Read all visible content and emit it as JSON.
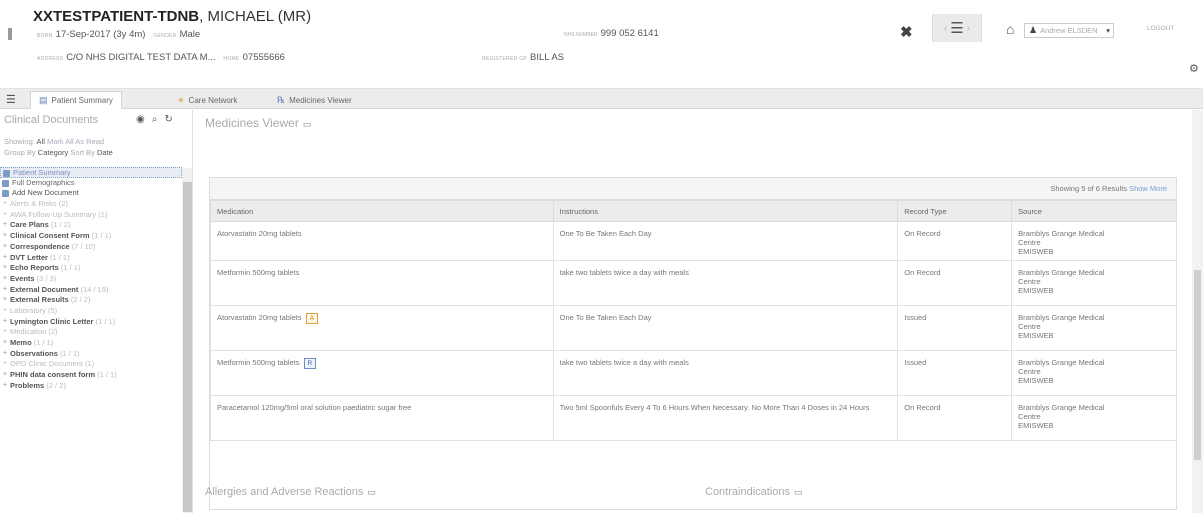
{
  "banner": {
    "patient_name_bold": "XXTESTPATIENT-TDNB",
    "patient_name_rest": ", MICHAEL (MR)",
    "born_label": "Born",
    "born_value": "17-Sep-2017 (3y 4m)",
    "gender_label": "Gender",
    "gender_value": "Male",
    "address_label": "Address",
    "address_value": "C/O NHS DIGITAL TEST DATA M...",
    "home_label": "Home",
    "home_value": "07555666",
    "registered_label": "Registered GP",
    "registered_value": "BILL AS",
    "nhs_label": "NHS Number",
    "nhs_value": "999 052 6141",
    "user_name": "Andrew ELSDEN",
    "logout_label": "LOGOUT"
  },
  "tabs": [
    {
      "label": "Patient Summary",
      "icon": "patient-summary-icon"
    },
    {
      "label": "Care Network",
      "icon": "care-network-icon"
    },
    {
      "label": "Medicines Viewer",
      "icon": "medicines-viewer-icon"
    }
  ],
  "left_panel": {
    "title": "Clinical Documents",
    "showing_label": "Showing:",
    "showing_all": "All",
    "mark_all_read": "Mark All As Read",
    "group_by_label": "Group By",
    "group_by_value": "Category",
    "sort_by_label": "Sort By",
    "sort_by_value": "Date",
    "doc_items": [
      {
        "label": "Patient Summary"
      },
      {
        "label": "Full Demographics"
      },
      {
        "label": "Add New Document"
      }
    ],
    "categories": [
      {
        "label": "Alerts & Risks",
        "count": "(2)",
        "bold": false
      },
      {
        "label": "AWA Follow-Up Summary",
        "count": "(1)",
        "bold": false
      },
      {
        "label": "Care Plans",
        "count": "(1 / 2)",
        "bold": true
      },
      {
        "label": "Clinical Consent Form",
        "count": "(1 / 1)",
        "bold": true
      },
      {
        "label": "Correspondence",
        "count": "(7 / 10)",
        "bold": true
      },
      {
        "label": "DVT Letter",
        "count": "(1 / 1)",
        "bold": true
      },
      {
        "label": "Echo Reports",
        "count": "(1 / 1)",
        "bold": true
      },
      {
        "label": "Events",
        "count": "(3 / 3)",
        "bold": true
      },
      {
        "label": "External Document",
        "count": "(14 / 19)",
        "bold": true
      },
      {
        "label": "External Results",
        "count": "(2 / 2)",
        "bold": true
      },
      {
        "label": "Laboratory",
        "count": "(5)",
        "bold": false
      },
      {
        "label": "Lymington Clinic Letter",
        "count": "(1 / 1)",
        "bold": true
      },
      {
        "label": "Medication",
        "count": "(2)",
        "bold": false
      },
      {
        "label": "Memo",
        "count": "(1 / 1)",
        "bold": true
      },
      {
        "label": "Observations",
        "count": "(1 / 1)",
        "bold": true
      },
      {
        "label": "OPD Clinic Document",
        "count": "(1)",
        "bold": false
      },
      {
        "label": "PHIN data consent form",
        "count": "(1 / 1)",
        "bold": true
      },
      {
        "label": "Problems",
        "count": "(2 / 2)",
        "bold": true
      }
    ]
  },
  "main": {
    "title": "Medicines Viewer",
    "showing_text": "Showing 5 of 6 Results",
    "show_more": "Show More",
    "columns": [
      "Medication",
      "Instructions",
      "Record Type",
      "Source"
    ],
    "rows": [
      {
        "medication": "Atorvastatin 20mg tablets",
        "badge": "",
        "badge_color": "",
        "instructions": "One To Be Taken Each Day",
        "record_type": "On Record",
        "source": [
          "Bramblys Grange Medical",
          "Centre",
          "EMISWEB"
        ]
      },
      {
        "medication": "Metformin 500mg tablets",
        "badge": "",
        "badge_color": "",
        "instructions": "take two tablets twice a day with meals",
        "record_type": "On Record",
        "source": [
          "Bramblys Grange Medical",
          "Centre",
          "EMISWEB"
        ]
      },
      {
        "medication": "Atorvastatin 20mg tablets",
        "badge": "A",
        "badge_color": "#e0a040",
        "instructions": "One To Be Taken Each Day",
        "record_type": "Issued",
        "source": [
          "Bramblys Grange Medical",
          "Centre",
          "EMISWEB"
        ]
      },
      {
        "medication": "Metformin 500mg tablets",
        "badge": "R",
        "badge_color": "#6f8fc8",
        "instructions": "take two tablets twice a day with meals",
        "record_type": "Issued",
        "source": [
          "Bramblys Grange Medical",
          "Centre",
          "EMISWEB"
        ]
      },
      {
        "medication": "Paracetamol 120mg/5ml oral solution paediatric sugar free",
        "badge": "",
        "badge_color": "",
        "instructions": "Two 5ml Spoonfuls Every 4 To 6 Hours When Necessary. No More Than 4 Doses in 24 Hours",
        "record_type": "On Record",
        "source": [
          "Bramblys Grange Medical",
          "Centre",
          "EMISWEB"
        ]
      }
    ],
    "allergies_title": "Allergies and Adverse Reactions",
    "contra_title": "Contraindications"
  }
}
